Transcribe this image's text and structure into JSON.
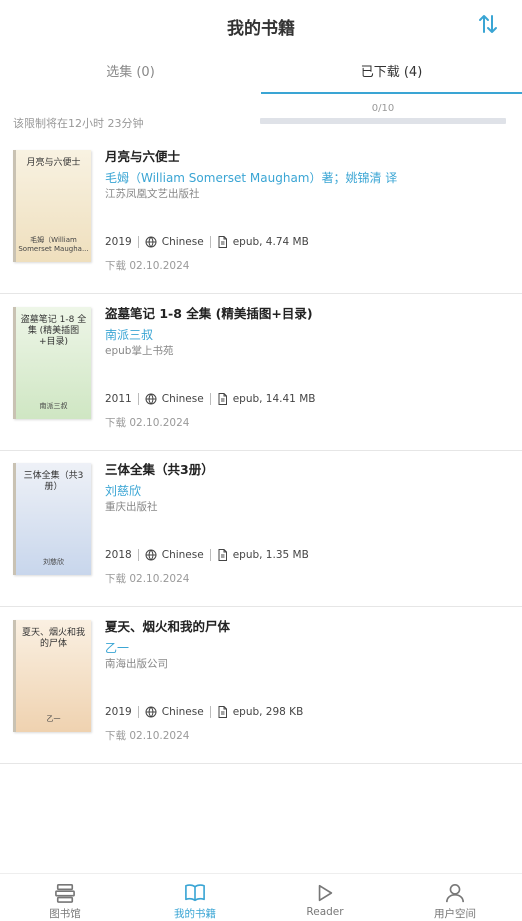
{
  "header": {
    "title": "我的书籍"
  },
  "tabs": [
    {
      "label": "选集 (0)",
      "active": false
    },
    {
      "label": "已下载 (4)",
      "active": true
    }
  ],
  "limit": {
    "text": "该限制将在12小时 23分钟",
    "quota_text": "0/10",
    "quota_fraction": 0
  },
  "books": [
    {
      "title": "月亮与六便士",
      "author": "毛姆（William Somerset Maugham）著；姚锦清 译",
      "publisher": "江苏凤凰文艺出版社",
      "year": "2019",
      "language": "Chinese",
      "file": "epub, 4.74 MB",
      "downloaded": "下载 02.10.2024",
      "cover_title": "月亮与六便士",
      "cover_author": "毛姆（William Somerset Maugha..."
    },
    {
      "title": "盗墓笔记 1-8 全集 (精美插图+目录)",
      "author": "南派三叔",
      "publisher": "epub掌上书苑",
      "year": "2011",
      "language": "Chinese",
      "file": "epub, 14.41 MB",
      "downloaded": "下载 02.10.2024",
      "cover_title": "盗墓笔记 1-8 全集 (精美插图+目录)",
      "cover_author": "南派三叔"
    },
    {
      "title": "三体全集（共3册）",
      "author": "刘慈欣",
      "publisher": "重庆出版社",
      "year": "2018",
      "language": "Chinese",
      "file": "epub, 1.35 MB",
      "downloaded": "下载 02.10.2024",
      "cover_title": "三体全集（共3册）",
      "cover_author": "刘慈欣"
    },
    {
      "title": "夏天、烟火和我的尸体",
      "author": "乙一",
      "publisher": "南海出版公司",
      "year": "2019",
      "language": "Chinese",
      "file": "epub, 298 KB",
      "downloaded": "下载 02.10.2024",
      "cover_title": "夏天、烟火和我的尸体",
      "cover_author": "乙一"
    }
  ],
  "nav": [
    {
      "label": "图书馆",
      "icon": "library-icon",
      "active": false
    },
    {
      "label": "我的书籍",
      "icon": "book-icon",
      "active": true
    },
    {
      "label": "Reader",
      "icon": "play-icon",
      "active": false
    },
    {
      "label": "用户空间",
      "icon": "user-icon",
      "active": false
    }
  ],
  "colors": {
    "accent": "#3aa5d4",
    "inactive": "#777777"
  }
}
